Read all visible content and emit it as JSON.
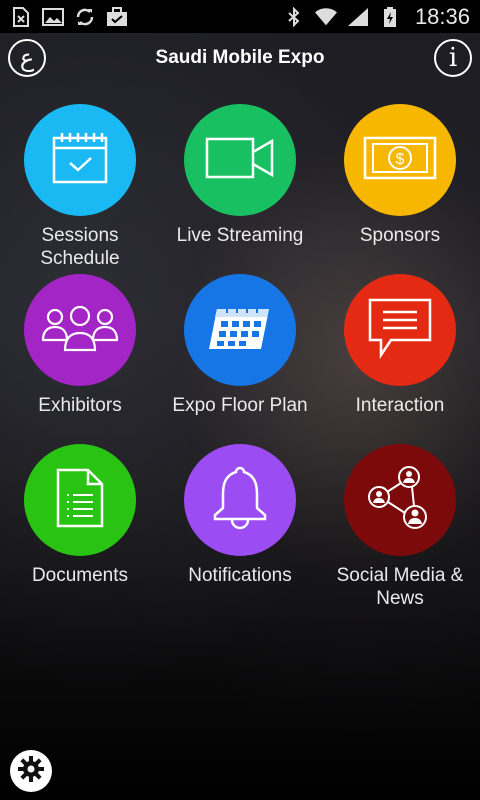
{
  "status_bar": {
    "time": "18:36",
    "left_icons": [
      "sim-icon",
      "image-icon",
      "sync-icon",
      "briefcase-check-icon"
    ],
    "right_icons": [
      "bluetooth-icon",
      "wifi-icon",
      "signal-icon",
      "battery-charging-icon"
    ]
  },
  "header": {
    "title": "Saudi Mobile Expo",
    "language_button": "ع",
    "info_button": "i"
  },
  "tiles": [
    {
      "label": "Sessions\nSchedule",
      "color": "#1ab9f3",
      "icon": "calendar-check-icon"
    },
    {
      "label": "Live Streaming",
      "color": "#19c062",
      "icon": "video-camera-icon"
    },
    {
      "label": "Sponsors",
      "color": "#f7b700",
      "icon": "dollar-bill-icon"
    },
    {
      "label": "Exhibitors",
      "color": "#a325c6",
      "icon": "people-group-icon"
    },
    {
      "label": "Expo Floor Plan",
      "color": "#1776e6",
      "icon": "floor-plan-calendar-icon"
    },
    {
      "label": "Interaction",
      "color": "#e52a13",
      "icon": "chat-bubble-icon"
    },
    {
      "label": "Documents",
      "color": "#28c313",
      "icon": "document-icon"
    },
    {
      "label": "Notifications",
      "color": "#9b4cf2",
      "icon": "bell-icon"
    },
    {
      "label": "Social Media &\nNews",
      "color": "#7c0a0a",
      "icon": "social-network-icon"
    }
  ],
  "footer": {
    "settings_icon": "gear-icon"
  }
}
